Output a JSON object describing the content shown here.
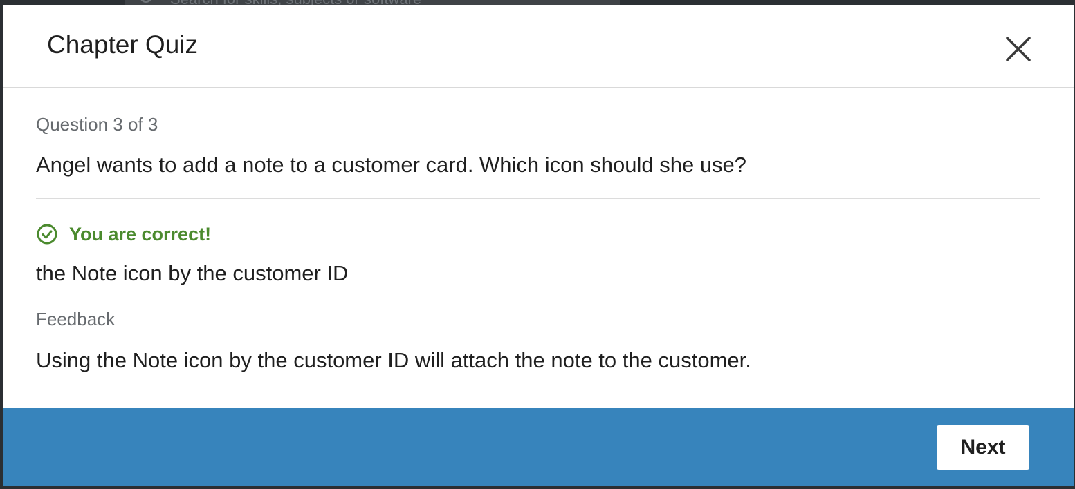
{
  "background": {
    "search_placeholder": "Search for skills, subjects or software"
  },
  "modal": {
    "title": "Chapter Quiz",
    "close_icon": "close-icon",
    "question": {
      "count_label": "Question 3 of 3",
      "text": "Angel wants to add a note to a customer card. Which icon should she use?"
    },
    "result": {
      "icon": "check-circle-icon",
      "text": "You are correct!",
      "color": "#4b8a2e"
    },
    "answer": "the Note icon by the customer ID",
    "feedback": {
      "label": "Feedback",
      "text": "Using the Note icon by the customer ID will attach the note to the customer."
    },
    "footer": {
      "color": "#3784bc",
      "next_label": "Next"
    }
  }
}
